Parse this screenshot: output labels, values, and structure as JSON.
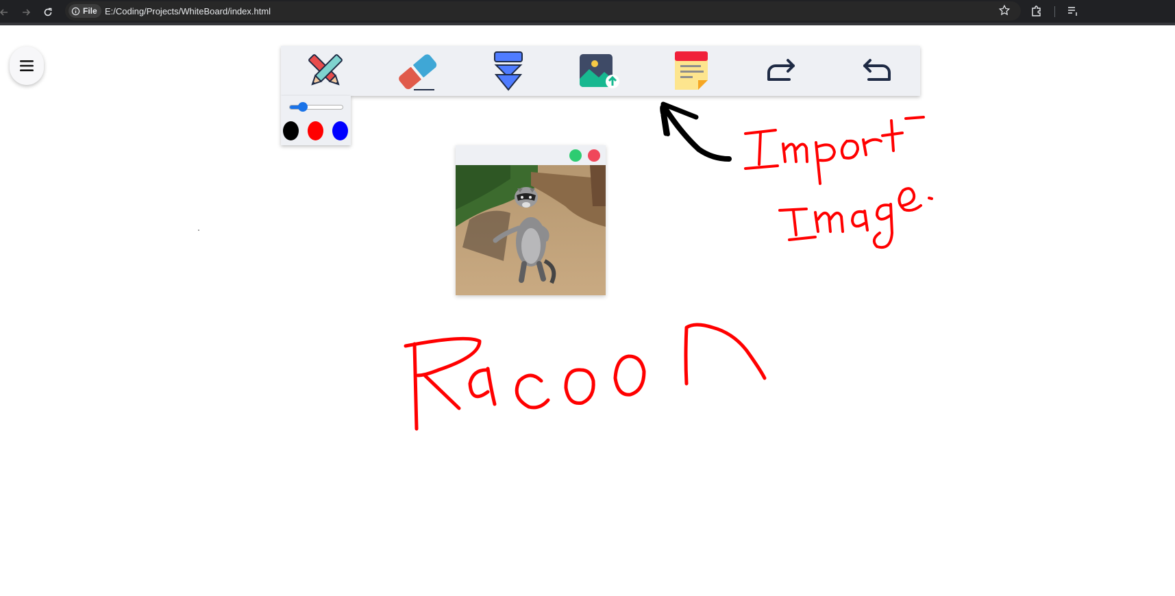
{
  "browser": {
    "scheme_label": "File",
    "url": "E:/Coding/Projects/WhiteBoard/index.html",
    "icons": [
      "back-icon",
      "forward-icon",
      "reload-icon",
      "info-icon",
      "star-icon",
      "extensions-icon",
      "media-icon"
    ]
  },
  "menu": {
    "icon": "hamburger-icon"
  },
  "toolbar": {
    "tools": [
      "pen-tool",
      "eraser-tool",
      "download-tool",
      "import-image-tool",
      "sticky-note-tool",
      "redo-tool",
      "undo-tool"
    ]
  },
  "pen_options": {
    "size_level": 0.25,
    "colors": [
      "#000000",
      "#ff0000",
      "#0000ff"
    ]
  },
  "image_card": {
    "controls": {
      "minimize_color": "#2ecc71",
      "close_color": "#f0475a"
    },
    "subject": "raccoon"
  },
  "annotations": {
    "ink_color": "#ff0000",
    "arrow_color": "#000000",
    "import_text": "Import Image",
    "racoon_text": "Racoon"
  }
}
